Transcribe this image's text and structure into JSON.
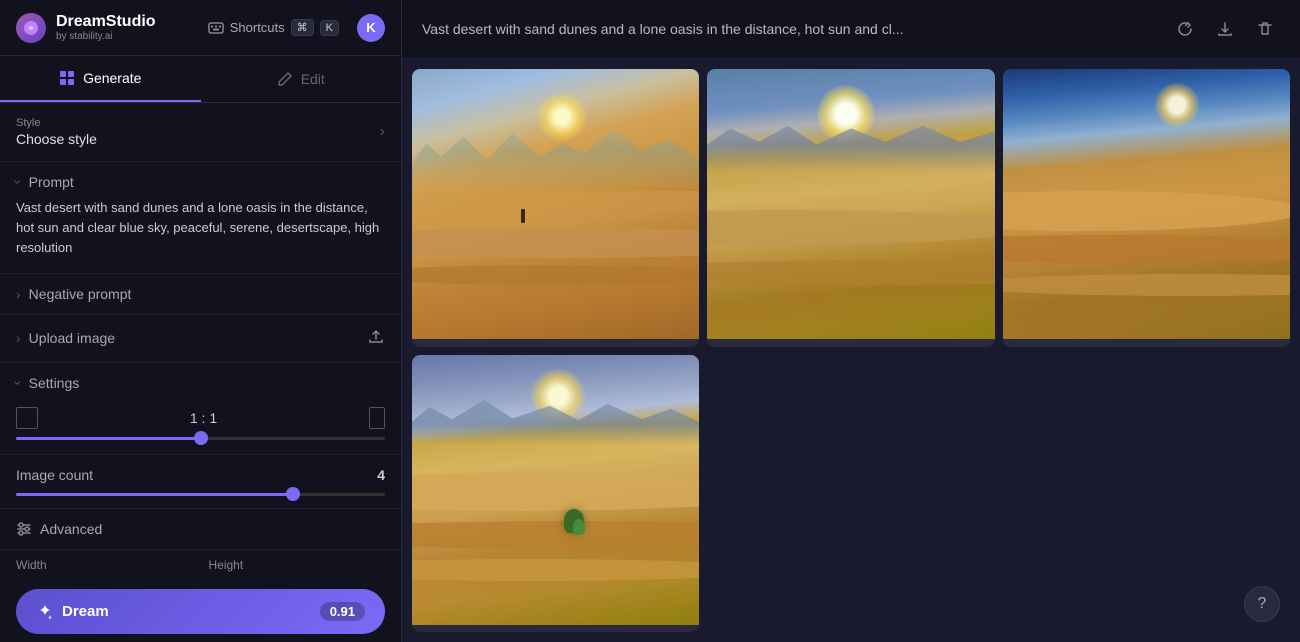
{
  "app": {
    "title": "DreamStudio",
    "subtitle": "by stability.ai",
    "logo_symbol": "🎨"
  },
  "topbar": {
    "shortcuts_label": "Shortcuts",
    "kbd1": "⌘",
    "kbd2": "K",
    "user_initial": "K"
  },
  "tabs": {
    "generate_label": "Generate",
    "edit_label": "Edit"
  },
  "sidebar": {
    "style_section_label": "Style",
    "style_value": "Choose style",
    "prompt_label": "Prompt",
    "prompt_text": "Vast desert with sand dunes and a lone oasis in the distance, hot sun and clear blue sky, peaceful, serene, desertscape, high resolution",
    "negative_prompt_label": "Negative prompt",
    "upload_image_label": "Upload image",
    "settings_label": "Settings",
    "aspect_ratio_value": "1 : 1",
    "image_count_label": "Image count",
    "image_count_value": "4",
    "advanced_label": "Advanced",
    "width_label": "Width",
    "height_label": "Height",
    "dream_label": "Dream",
    "dream_credit": "0.91"
  },
  "images_header": {
    "prompt_display": "Vast desert with sand dunes and a lone oasis in the distance, hot sun and cl...",
    "refresh_icon": "↻",
    "download_icon": "⬇",
    "delete_icon": "🗑"
  },
  "sliders": {
    "aspect_ratio_percent": 50,
    "image_count_percent": 75
  },
  "help": {
    "icon": "?"
  }
}
